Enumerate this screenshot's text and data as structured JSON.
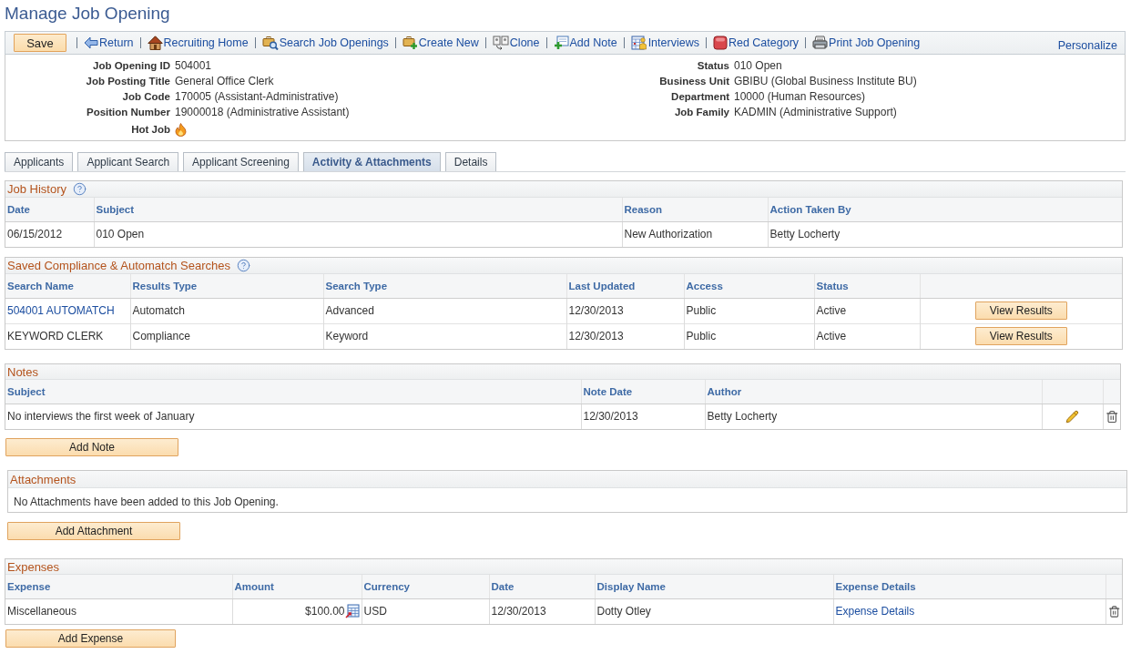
{
  "page_title": "Manage Job Opening",
  "toolbar": {
    "save_button": "Save",
    "actions": [
      {
        "kind": "return",
        "label": "Return"
      },
      {
        "kind": "home",
        "label": "Recruiting Home"
      },
      {
        "kind": "search",
        "label": "Search Job Openings"
      },
      {
        "kind": "create",
        "label": "Create New"
      },
      {
        "kind": "clone",
        "label": "Clone"
      },
      {
        "kind": "note",
        "label": "Add Note"
      },
      {
        "kind": "interviews",
        "label": "Interviews"
      },
      {
        "kind": "category",
        "label": "Red Category"
      },
      {
        "kind": "print",
        "label": "Print Job Opening"
      }
    ],
    "personalize": "Personalize"
  },
  "summary": {
    "left": [
      {
        "label": "Job Opening ID",
        "value": "504001"
      },
      {
        "label": "Job Posting Title",
        "value": "General Office Clerk"
      },
      {
        "label": "Job Code",
        "value": "170005 (Assistant-Administrative)"
      },
      {
        "label": "Position Number",
        "value": "19000018 (Administrative Assistant)"
      }
    ],
    "hot_job": {
      "label": "Hot Job",
      "on": true
    },
    "right": [
      {
        "label": "Status",
        "value": "010 Open"
      },
      {
        "label": "Business Unit",
        "value": "GBIBU (Global Business Institute BU)"
      },
      {
        "label": "Department",
        "value": "10000 (Human Resources)"
      },
      {
        "label": "Job Family",
        "value": "KADMIN (Administrative Support)"
      }
    ]
  },
  "tabs": [
    {
      "label": "Applicants",
      "selected": false
    },
    {
      "label": "Applicant Search",
      "selected": false
    },
    {
      "label": "Applicant Screening",
      "selected": false
    },
    {
      "label": "Activity & Attachments",
      "selected": true
    },
    {
      "label": "Details",
      "selected": false
    }
  ],
  "job_history": {
    "title": "Job History",
    "help": true,
    "columns": [
      "Date",
      "Subject",
      "Reason",
      "Action Taken By"
    ],
    "rows": [
      {
        "cells": [
          "06/15/2012",
          "010 Open",
          "New Authorization",
          "Betty Locherty"
        ]
      }
    ]
  },
  "saved_searches": {
    "title": "Saved Compliance & Automatch Searches",
    "help": true,
    "columns": [
      "Search Name",
      "Results Type",
      "Search Type",
      "Last Updated",
      "Access",
      "Status"
    ],
    "rows": [
      {
        "cells": [
          "504001 AUTOMATCH",
          "Automatch",
          "Advanced",
          "12/30/2013",
          "Public",
          "Active"
        ],
        "name_linked": true,
        "action": "View Results"
      },
      {
        "cells": [
          "KEYWORD CLERK",
          "Compliance",
          "Keyword",
          "12/30/2013",
          "Public",
          "Active"
        ],
        "name_linked": false,
        "action": "View Results"
      }
    ]
  },
  "notes": {
    "title": "Notes",
    "columns": [
      "Subject",
      "Note Date",
      "Author"
    ],
    "rows": [
      {
        "cells": [
          "No interviews the first week of January",
          "12/30/2013",
          "Betty Locherty"
        ]
      }
    ],
    "add_button": "Add Note"
  },
  "attachments": {
    "title": "Attachments",
    "message": "No Attachments have been added to this Job Opening.",
    "add_button": "Add Attachment"
  },
  "expenses": {
    "title": "Expenses",
    "columns": [
      {
        "label": "Expense",
        "kind": "text"
      },
      {
        "label": "Amount",
        "kind": "money"
      },
      {
        "label": "Currency",
        "kind": "text"
      },
      {
        "label": "Date",
        "kind": "text"
      },
      {
        "label": "Display Name",
        "kind": "text"
      },
      {
        "label": "Expense Details",
        "kind": "link"
      }
    ],
    "rows": [
      {
        "cells": [
          "Miscellaneous",
          "$100.00",
          "USD",
          "12/30/2013",
          "Dotty Otley",
          "Expense Details"
        ]
      }
    ],
    "add_button": "Add Expense"
  }
}
